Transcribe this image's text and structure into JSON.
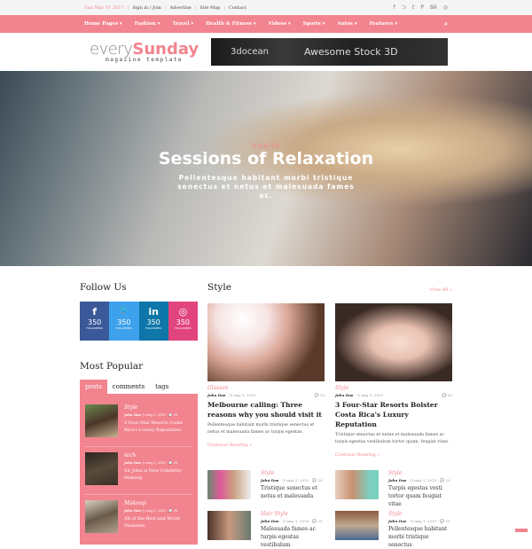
{
  "topbar": {
    "date": "Sun May 07 2017",
    "links": [
      "Sign in / Join",
      "Advertise",
      "Site Map",
      "Contact"
    ],
    "social": [
      "f",
      "⊃",
      "t",
      "P",
      "Bē",
      "◎"
    ]
  },
  "nav": {
    "items": [
      "Home Pages ▾",
      "Fashion ▾",
      "Travel ▾",
      "Health & Fitness ▾",
      "Videos ▾",
      "Sports ▾",
      "Autos ▾",
      "Features ▾"
    ],
    "search_icon": "⌕"
  },
  "logo": {
    "part1": "every",
    "part2": "Sunday",
    "tagline": "magazine template"
  },
  "banner": {
    "brand": "3docean",
    "text": "Awesome Stock 3D"
  },
  "hero": {
    "category": "Health",
    "title": "Sessions of Relaxation",
    "text": "Pellentesque habitant morbi tristique senectus et netus et malesuada fames ac."
  },
  "follow": {
    "title": "Follow Us",
    "items": [
      {
        "icon": "f",
        "count": "350",
        "label": "FOLLOWERS",
        "color": "#3b5998"
      },
      {
        "icon": "🐦",
        "count": "350",
        "label": "FOLLOWERS",
        "color": "#3ea1ec"
      },
      {
        "icon": "in",
        "count": "350",
        "label": "FOLLOWERS",
        "color": "#0e76a8"
      },
      {
        "icon": "◎",
        "count": "350",
        "label": "FOLLOWERS",
        "color": "#e2457d"
      }
    ]
  },
  "popular": {
    "title": "Most Popular",
    "tabs": [
      "posts",
      "comments",
      "tags"
    ],
    "items": [
      {
        "cat": "Style",
        "author": "John Doe",
        "date": "may 1, 2015",
        "comments": "20",
        "title": "3 Four-Star Resorts Costa Rica's Luxury Reputation"
      },
      {
        "cat": "tech",
        "author": "John Doe",
        "date": "may 1, 2015",
        "comments": "20",
        "title": "Sir John is New Celebrity Makeup"
      },
      {
        "cat": "Makeup",
        "author": "John Doe",
        "date": "may 1, 2015",
        "comments": "20",
        "title": "All of the Best and Worst Moments"
      }
    ]
  },
  "style": {
    "title": "Style",
    "view_all": "View All »",
    "cards": [
      {
        "cat": "Glasses",
        "author": "John Doe",
        "date": "may 1, 2015",
        "comments": "20",
        "title": "Melbourne calling: Three reasons why you should visit it",
        "text": "Pellentesque habitant morbi tristique senectus et netus et malesuada fames ac turpis egestas.",
        "more": "Continue Reading »"
      },
      {
        "cat": "Style",
        "author": "John Doe",
        "date": "may 1, 2015",
        "comments": "20",
        "title": "3 Four-Star Resorts Bolster Costa Rica's Luxury Reputation",
        "text": "Tristique senectus et netus et malesuada fames ac turpis egestas vestibulum tortor quam, feugiat vitae.",
        "more": "Continue Reading »"
      }
    ],
    "small": [
      {
        "cat": "Style",
        "author": "John Doe",
        "date": "may 1, 2015",
        "comments": "20",
        "title": "Tristique senectus et netus et malesuada"
      },
      {
        "cat": "Style",
        "author": "John Doe",
        "date": "may 1, 2015",
        "comments": "20",
        "title": "Turpis egestas vesti tortor quam feugiat vitae"
      },
      {
        "cat": "Hair Style",
        "author": "John Doe",
        "date": "may 1, 2015",
        "comments": "20",
        "title": "Malesuada fames ac turpis egestas vestibulum"
      },
      {
        "cat": "Style",
        "author": "John Doe",
        "date": "may 1, 2015",
        "comments": "20",
        "title": "Pellentesque habitant morbi tristique senectus"
      }
    ]
  }
}
